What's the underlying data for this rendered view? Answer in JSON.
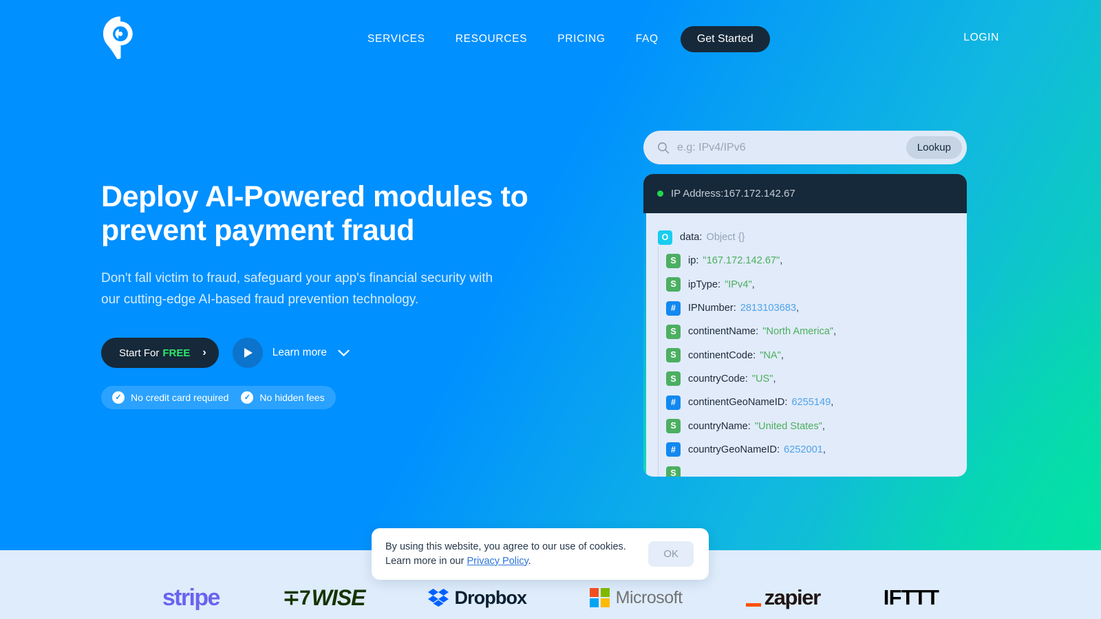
{
  "nav": {
    "logo_icon": "location-pin-logo",
    "links": [
      {
        "label": "SERVICES"
      },
      {
        "label": "RESOURCES"
      },
      {
        "label": "PRICING"
      },
      {
        "label": "FAQ"
      }
    ],
    "get_started_label": "Get Started",
    "login_label": "LOGIN"
  },
  "hero": {
    "headline": "Deploy AI-Powered modules to prevent payment fraud",
    "subhead": "Don't fall victim to fraud, safeguard your app's financial security with our cutting-edge AI-based fraud prevention technology.",
    "cta_primary_prefix": "Start For",
    "cta_primary_highlight": "FREE",
    "cta_primary_chevron": "›",
    "play_icon": "play-icon",
    "learn_more_label": "Learn more",
    "learn_more_chevron": "chevron-down-icon",
    "badges": [
      {
        "icon": "check-circle-icon",
        "label": "No credit card required"
      },
      {
        "icon": "check-circle-icon",
        "label": "No hidden fees"
      }
    ]
  },
  "lookup": {
    "search_icon": "search-icon",
    "placeholder": "e.g: IPv4/IPv6",
    "value": "",
    "button_label": "Lookup"
  },
  "result": {
    "status_icon": "status-dot-online",
    "header": "IP Address:167.172.142.67",
    "rows": [
      {
        "tag": "O",
        "tag_type": "o",
        "key": "data",
        "value": "Object {}",
        "value_type": "obj",
        "comma": "",
        "child": false
      },
      {
        "tag": "S",
        "tag_type": "s",
        "key": "ip",
        "value": "\"167.172.142.67\"",
        "value_type": "str",
        "comma": ",",
        "child": true
      },
      {
        "tag": "S",
        "tag_type": "s",
        "key": "ipType",
        "value": "\"IPv4\"",
        "value_type": "str",
        "comma": ",",
        "child": true
      },
      {
        "tag": "#",
        "tag_type": "n",
        "key": "IPNumber",
        "value": "2813103683",
        "value_type": "num",
        "comma": ",",
        "child": true
      },
      {
        "tag": "S",
        "tag_type": "s",
        "key": "continentName",
        "value": "\"North America\"",
        "value_type": "str",
        "comma": ",",
        "child": true
      },
      {
        "tag": "S",
        "tag_type": "s",
        "key": "continentCode",
        "value": "\"NA\"",
        "value_type": "str",
        "comma": ",",
        "child": true
      },
      {
        "tag": "S",
        "tag_type": "s",
        "key": "countryCode",
        "value": "\"US\"",
        "value_type": "str",
        "comma": ",",
        "child": true
      },
      {
        "tag": "#",
        "tag_type": "n",
        "key": "continentGeoNameID",
        "value": "6255149",
        "value_type": "num",
        "comma": ",",
        "child": true
      },
      {
        "tag": "S",
        "tag_type": "s",
        "key": "countryName",
        "value": "\"United States\"",
        "value_type": "str",
        "comma": ",",
        "child": true
      },
      {
        "tag": "#",
        "tag_type": "n",
        "key": "countryGeoNameID",
        "value": "6252001",
        "value_type": "num",
        "comma": ",",
        "child": true
      },
      {
        "tag": "S",
        "tag_type": "s",
        "key": "",
        "value": "",
        "value_type": "str",
        "comma": "",
        "child": true
      }
    ]
  },
  "cookie": {
    "line1": "By using this website, you agree to our use of cookies.",
    "line2_prefix": "Learn more in our ",
    "link_label": "Privacy Policy",
    "line2_suffix": ".",
    "ok_label": "OK"
  },
  "partners": [
    {
      "name": "stripe",
      "label": "stripe"
    },
    {
      "name": "wise",
      "label": "WISE"
    },
    {
      "name": "dropbox",
      "label": "Dropbox"
    },
    {
      "name": "microsoft",
      "label": "Microsoft"
    },
    {
      "name": "zapier",
      "label": "zapier"
    },
    {
      "name": "ifttt",
      "label": "IFTTT"
    }
  ],
  "colors": {
    "brand_blue": "#0090ff",
    "brand_teal": "#07dda6",
    "dark": "#16293a",
    "green_accent": "#2ee86a",
    "json_string": "#4cae5e",
    "json_number": "#51a3e8"
  }
}
